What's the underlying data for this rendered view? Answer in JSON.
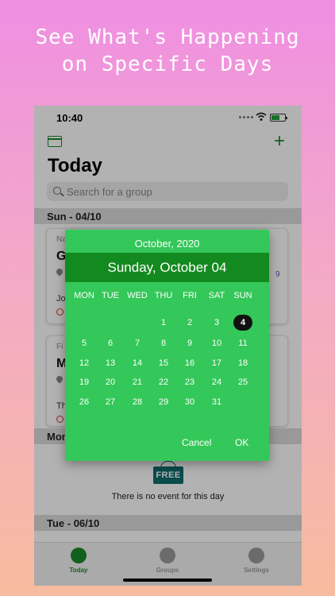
{
  "promo": {
    "line1": "See What's Happening",
    "line2": "on Specific Days"
  },
  "status": {
    "time": "10:40"
  },
  "header": {
    "title": "Today",
    "search_placeholder": "Search for a group"
  },
  "sections": {
    "s1": "Sun - 04/10",
    "s2": "Mon",
    "s3": "Tue - 06/10"
  },
  "cards": [
    {
      "label": "Na",
      "title": "G",
      "who": "Jo",
      "num": "9"
    },
    {
      "label": "Fi",
      "title": "M",
      "who": "Th",
      "num": ""
    }
  ],
  "empty": {
    "badge": "FREE",
    "text": "There is no event for this day"
  },
  "tabs": [
    {
      "label": "Today",
      "icon": "clock-icon"
    },
    {
      "label": "Groups",
      "icon": "people-icon"
    },
    {
      "label": "Settings",
      "icon": "gear-icon"
    }
  ],
  "picker": {
    "month_label": "October, 2020",
    "selected_label": "Sunday, October 04",
    "weekdays": [
      "MON",
      "TUE",
      "WED",
      "THU",
      "FRI",
      "SAT",
      "SUN"
    ],
    "weeks": [
      [
        "",
        "",
        "",
        "1",
        "2",
        "3",
        "4"
      ],
      [
        "5",
        "6",
        "7",
        "8",
        "9",
        "10",
        "11"
      ],
      [
        "12",
        "13",
        "14",
        "15",
        "16",
        "17",
        "18"
      ],
      [
        "19",
        "20",
        "21",
        "22",
        "23",
        "24",
        "25"
      ],
      [
        "26",
        "27",
        "28",
        "29",
        "30",
        "31",
        ""
      ]
    ],
    "selected_day": "4",
    "cancel_label": "Cancel",
    "ok_label": "OK"
  },
  "colors": {
    "accent": "#34c759",
    "banner": "#138a1f"
  }
}
